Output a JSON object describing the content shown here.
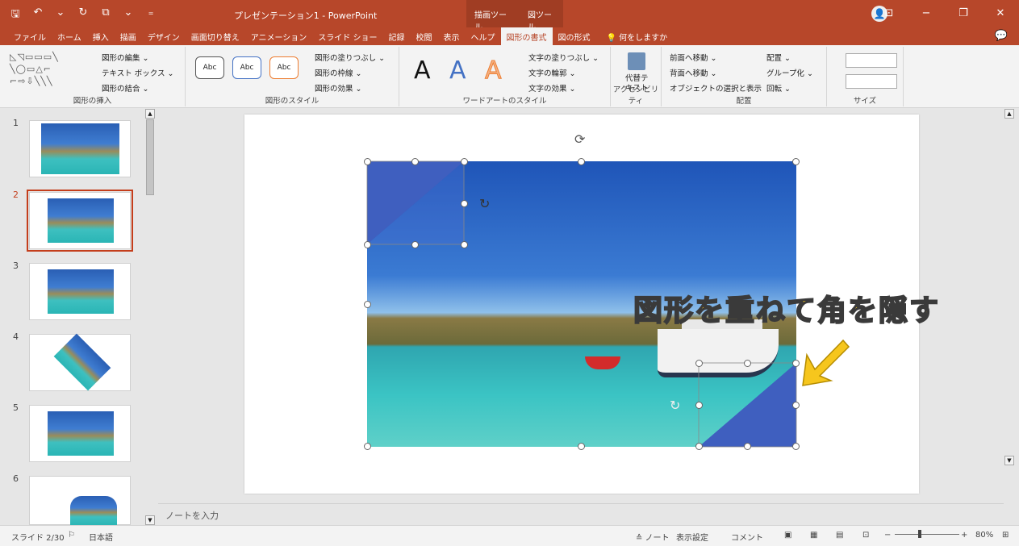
{
  "titlebar": {
    "qat": [
      "🖫",
      "↶",
      "⌄",
      "↻",
      "⧉",
      "⌄",
      "₌"
    ],
    "title": "プレゼンテーション1 - PowerPoint",
    "context_tabs": [
      "描画ツール",
      "図ツール"
    ],
    "avatar": "👤",
    "window_buttons": [
      "⊡",
      "−",
      "❐",
      "✕"
    ]
  },
  "tabs": [
    "ファイル",
    "ホーム",
    "挿入",
    "描画",
    "デザイン",
    "画面切り替え",
    "アニメーション",
    "スライド ショー",
    "記録",
    "校閲",
    "表示",
    "ヘルプ",
    "図形の書式",
    "図の形式"
  ],
  "active_tab": "図形の書式",
  "tell_me": "何をしますか",
  "comment_icon": "💬",
  "ribbon": {
    "insert_shapes": {
      "gallery": "◺◹▭▭▭╲\n╲◯▭△⌐\n⌐⇨⇩╲╲╲",
      "edit_shape": "図形の編集 ⌄",
      "text_box": "テキスト ボックス ⌄",
      "merge_shapes": "図形の結合 ⌄",
      "label": "図形の挿入"
    },
    "shape_styles": {
      "samples": [
        "Abc",
        "Abc",
        "Abc"
      ],
      "fill": "図形の塗りつぶし ⌄",
      "outline": "図形の枠線 ⌄",
      "effects": "図形の効果 ⌄",
      "label": "図形のスタイル"
    },
    "wordart": {
      "letters": [
        "A",
        "A",
        "A"
      ],
      "text_fill": "文字の塗りつぶし ⌄",
      "text_outline": "文字の輪郭 ⌄",
      "text_effects": "文字の効果 ⌄",
      "label": "ワードアートのスタイル"
    },
    "accessibility": {
      "alt_text": "代替テ\nキスト",
      "label": "アクセシビリティ"
    },
    "arrange": {
      "bring_forward": "前面へ移動 ⌄",
      "send_backward": "背面へ移動 ⌄",
      "selection_pane": "オブジェクトの選択と表示",
      "align": "配置 ⌄",
      "group": "グループ化 ⌄",
      "rotate": "回転 ⌄",
      "label": "配置"
    },
    "size": {
      "height": "",
      "width": "",
      "label": "サイズ"
    }
  },
  "thumbnails": [
    {
      "num": "1"
    },
    {
      "num": "2"
    },
    {
      "num": "3"
    },
    {
      "num": "4"
    },
    {
      "num": "5"
    },
    {
      "num": "6"
    }
  ],
  "slide": {
    "caption": "図形を重ねて角を隠す"
  },
  "notes_placeholder": "ノートを入力",
  "status": {
    "slide": "スライド 2/30",
    "language": "日本語",
    "notes": "≙ ノート",
    "display": "表示設定",
    "comments": "コメント",
    "zoom": "80%"
  },
  "colors": {
    "accent": "#b7472a",
    "triangle": "#3f5fbf",
    "caption": "#f6c61d"
  }
}
